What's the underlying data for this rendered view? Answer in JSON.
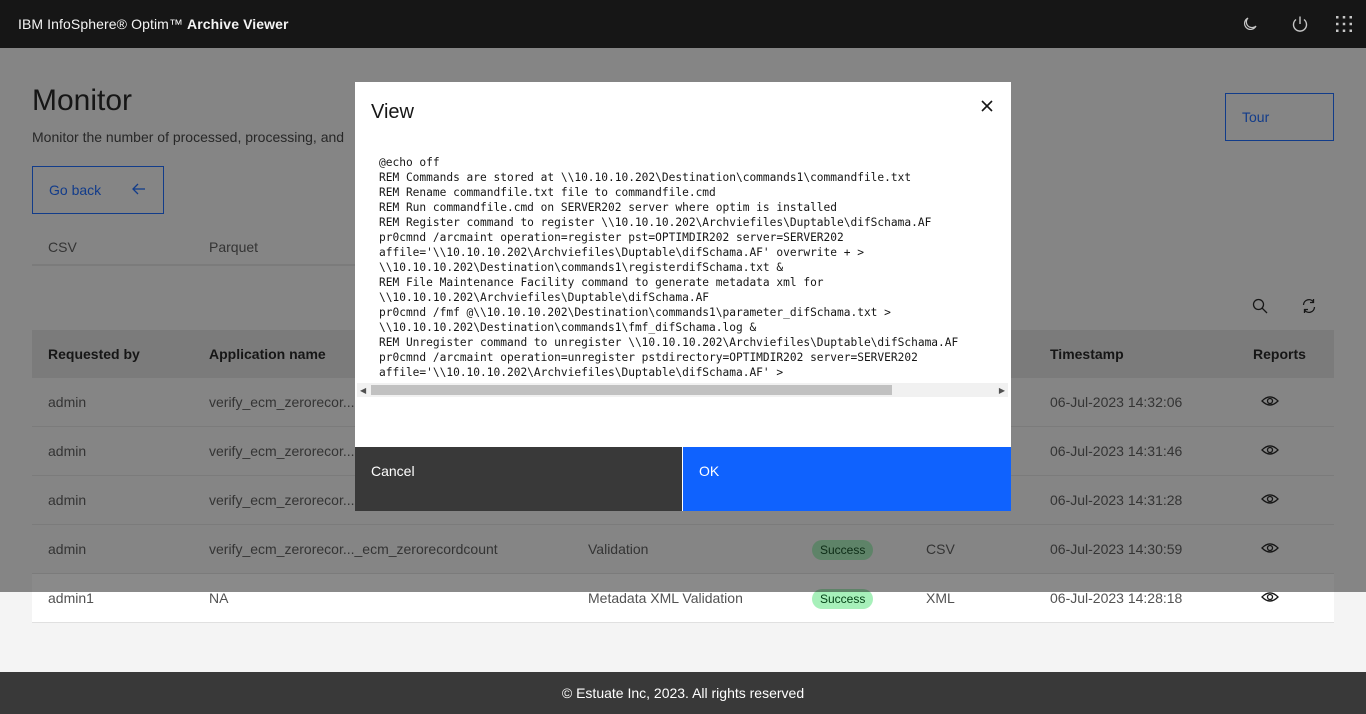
{
  "header": {
    "brand_light": "IBM InfoSphere® Optim™ ",
    "brand_bold": "Archive Viewer",
    "icons": [
      "moon-icon",
      "power-icon",
      "app-switcher-icon"
    ]
  },
  "page": {
    "title": "Monitor",
    "subtitle": "Monitor the number of processed, processing, and",
    "tour_label": "Tour",
    "goback_label": "Go back"
  },
  "tabs": [
    {
      "label": "CSV"
    },
    {
      "label": "Parquet"
    }
  ],
  "table": {
    "headers": {
      "requested_by": "Requested by",
      "application_name": "Application name",
      "timestamp": "Timestamp",
      "reports": "Reports"
    },
    "rows": [
      {
        "requested_by": "admin",
        "application_name": "verify_ecm_zerorecor...",
        "process": "",
        "status": "",
        "format": "",
        "timestamp": "06-Jul-2023 14:32:06"
      },
      {
        "requested_by": "admin",
        "application_name": "verify_ecm_zerorecor...",
        "process": "",
        "status": "",
        "format": "",
        "timestamp": "06-Jul-2023 14:31:46"
      },
      {
        "requested_by": "admin",
        "application_name": "verify_ecm_zerorecor...",
        "process": "",
        "status": "",
        "format": "",
        "timestamp": "06-Jul-2023 14:31:28"
      },
      {
        "requested_by": "admin",
        "application_name": "verify_ecm_zerorecor..._ecm_zerorecordcount",
        "process": "Validation",
        "status": "Success",
        "format": "CSV",
        "timestamp": "06-Jul-2023 14:30:59"
      },
      {
        "requested_by": "admin1",
        "application_name": "NA",
        "process": "Metadata XML Validation",
        "status": "Success",
        "format": "XML",
        "timestamp": "06-Jul-2023 14:28:18"
      }
    ]
  },
  "footer": {
    "text": "© Estuate Inc, 2023.  All rights reserved"
  },
  "modal": {
    "title": "View",
    "cancel_label": "Cancel",
    "ok_label": "OK",
    "code": "@echo off\nREM Commands are stored at \\\\10.10.10.202\\Destination\\commands1\\commandfile.txt\nREM Rename commandfile.txt file to commandfile.cmd\nREM Run commandfile.cmd on SERVER202 server where optim is installed\nREM Register command to register \\\\10.10.10.202\\Archviefiles\\Duptable\\difSchama.AF\npr0cmnd /arcmaint operation=register pst=OPTIMDIR202 server=SERVER202\naffile='\\\\10.10.10.202\\Archviefiles\\Duptable\\difSchama.AF' overwrite + >\n\\\\10.10.10.202\\Destination\\commands1\\registerdifSchama.txt &\nREM File Maintenance Facility command to generate metadata xml for\n\\\\10.10.10.202\\Archviefiles\\Duptable\\difSchama.AF\npr0cmnd /fmf @\\\\10.10.10.202\\Destination\\commands1\\parameter_difSchama.txt >\n\\\\10.10.10.202\\Destination\\commands1\\fmf_difSchama.log &\nREM Unregister command to unregister \\\\10.10.10.202\\Archviefiles\\Duptable\\difSchama.AF\npr0cmnd /arcmaint operation=unregister pstdirectory=OPTIMDIR202 server=SERVER202\naffile='\\\\10.10.10.202\\Archviefiles\\Duptable\\difSchama.AF' >"
  }
}
